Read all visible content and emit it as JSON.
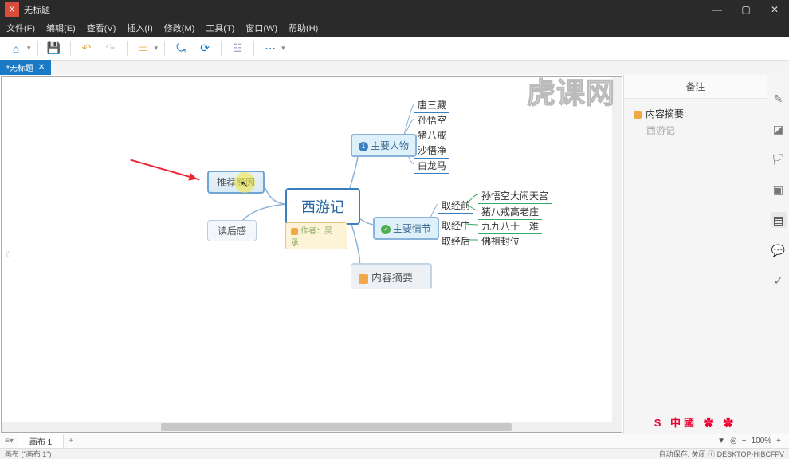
{
  "window": {
    "title": "无标题",
    "app_icon_char": "X"
  },
  "menu": [
    "文件(F)",
    "编辑(E)",
    "查看(V)",
    "插入(I)",
    "修改(M)",
    "工具(T)",
    "窗口(W)",
    "帮助(H)"
  ],
  "toolbar_icons": [
    "home",
    "save",
    "undo",
    "redo",
    "open",
    "share",
    "refresh",
    "export",
    "more"
  ],
  "doc_tab": {
    "label": "*无标题"
  },
  "central": {
    "title": "西游记",
    "footer_prefix": "作者：",
    "footer_author": "吴承..."
  },
  "branches": {
    "recommend": "推荐原因",
    "review": "读后感",
    "characters": "主要人物",
    "plot": "主要情节",
    "summary": "内容摘要"
  },
  "characters_list": [
    "唐三藏",
    "孙悟空",
    "猪八戒",
    "沙悟净",
    "白龙马"
  ],
  "plot_stages": [
    "取经前",
    "取经中",
    "取经后"
  ],
  "plot_events": [
    "孙悟空大闹天宫",
    "猪八戒高老庄",
    "九九八十一难",
    "佛祖封位"
  ],
  "notes_panel": {
    "title": "备注",
    "heading": "内容摘要:",
    "content": "西游记"
  },
  "sheet": {
    "label": "画布 1"
  },
  "zoom": {
    "value": "100%"
  },
  "status": {
    "left": "画布 (\"画布 1\")",
    "right": "自动保存: 关闭 ⓘ DESKTOP-HIBCFFV"
  },
  "watermark": "虎课网",
  "brand_footer": "S 中國 ✿ ✿"
}
